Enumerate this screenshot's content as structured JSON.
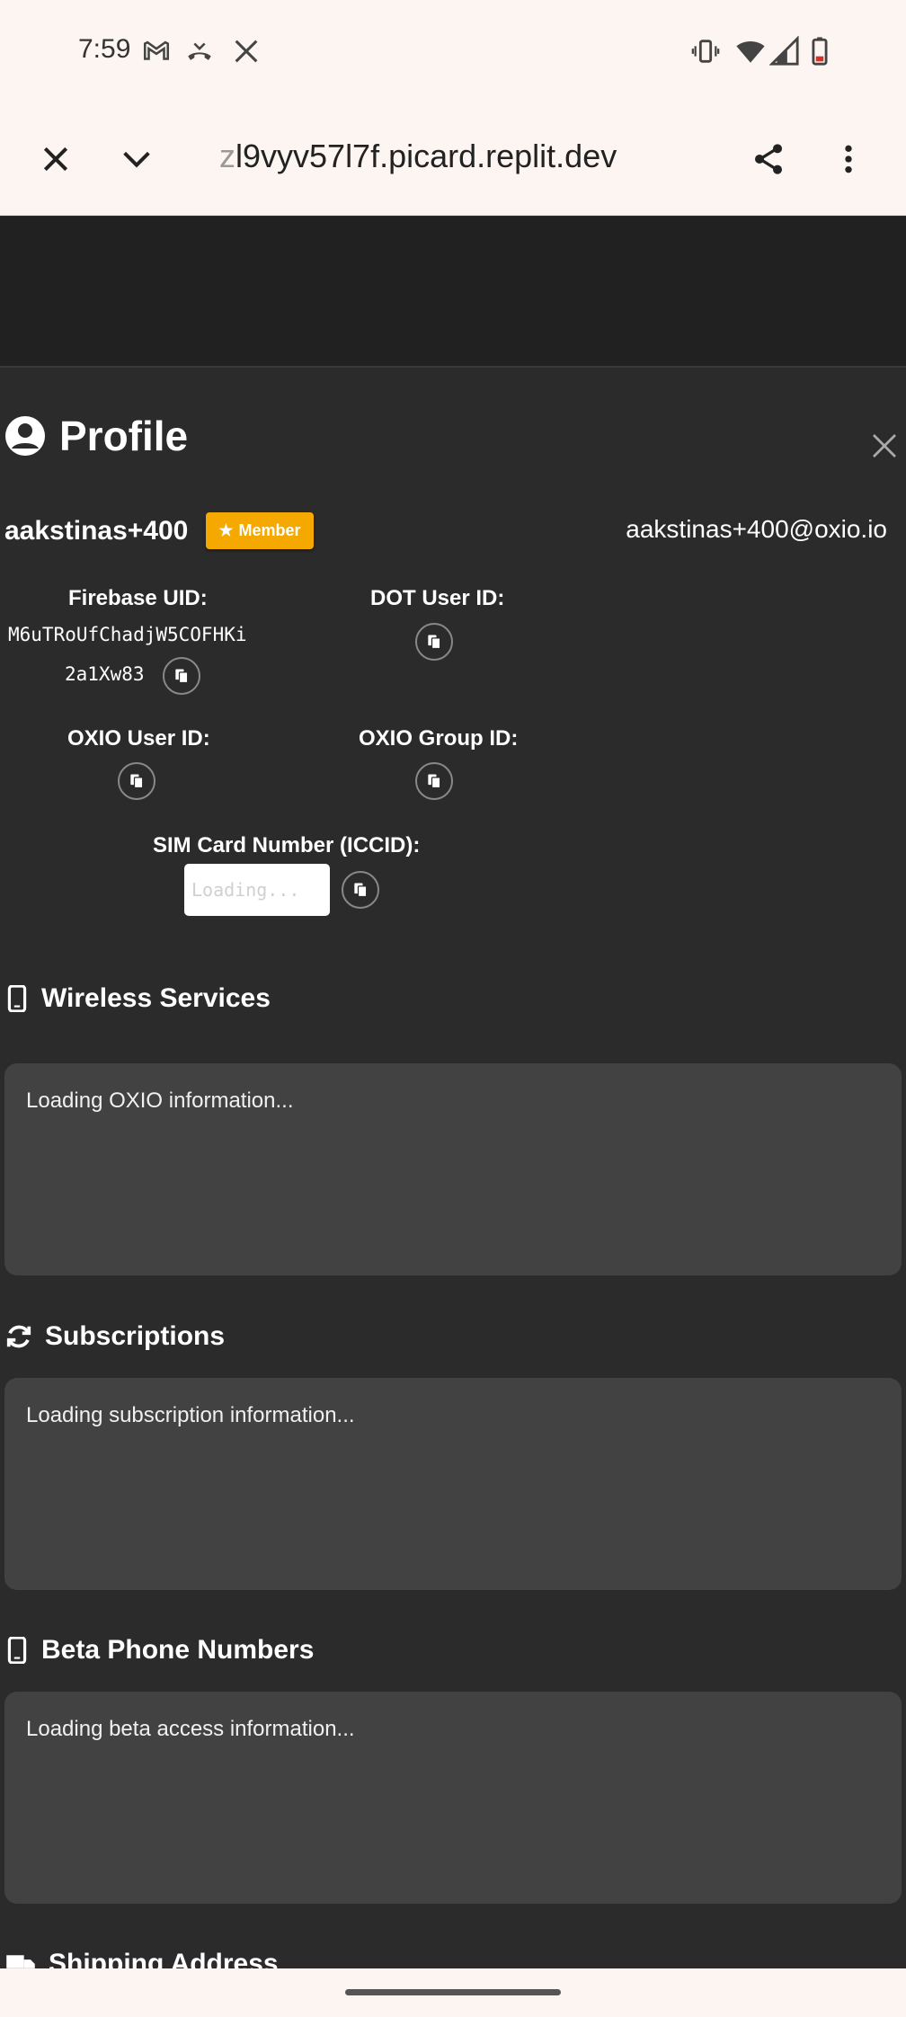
{
  "status_bar": {
    "time": "7:59"
  },
  "browser": {
    "url_fade": "z",
    "url": "l9vyv57l7f.picard.replit.dev"
  },
  "profile": {
    "title": "Profile",
    "username": "aakstinas+400",
    "badge": "Member",
    "email": "aakstinas+400@oxio.io",
    "firebase_uid_label": "Firebase UID:",
    "firebase_uid_line1": "M6uTRoUfChadjW5COFHKi",
    "firebase_uid_line2": "2a1Xw83",
    "dot_user_id_label": "DOT User ID:",
    "oxio_user_id_label": "OXIO User ID:",
    "oxio_group_id_label": "OXIO Group ID:",
    "sim_label": "SIM Card Number (ICCID):",
    "sim_value": "Loading..."
  },
  "sections": {
    "wireless": {
      "title": "Wireless Services",
      "text": "Loading OXIO information..."
    },
    "subscriptions": {
      "title": "Subscriptions",
      "text": "Loading subscription information..."
    },
    "beta": {
      "title": "Beta Phone Numbers",
      "text": "Loading beta access information..."
    },
    "shipping": {
      "title": "Shipping Address"
    }
  },
  "colors": {
    "badge": "#f5a800",
    "card": "#424242",
    "background": "#2b2b2b"
  }
}
